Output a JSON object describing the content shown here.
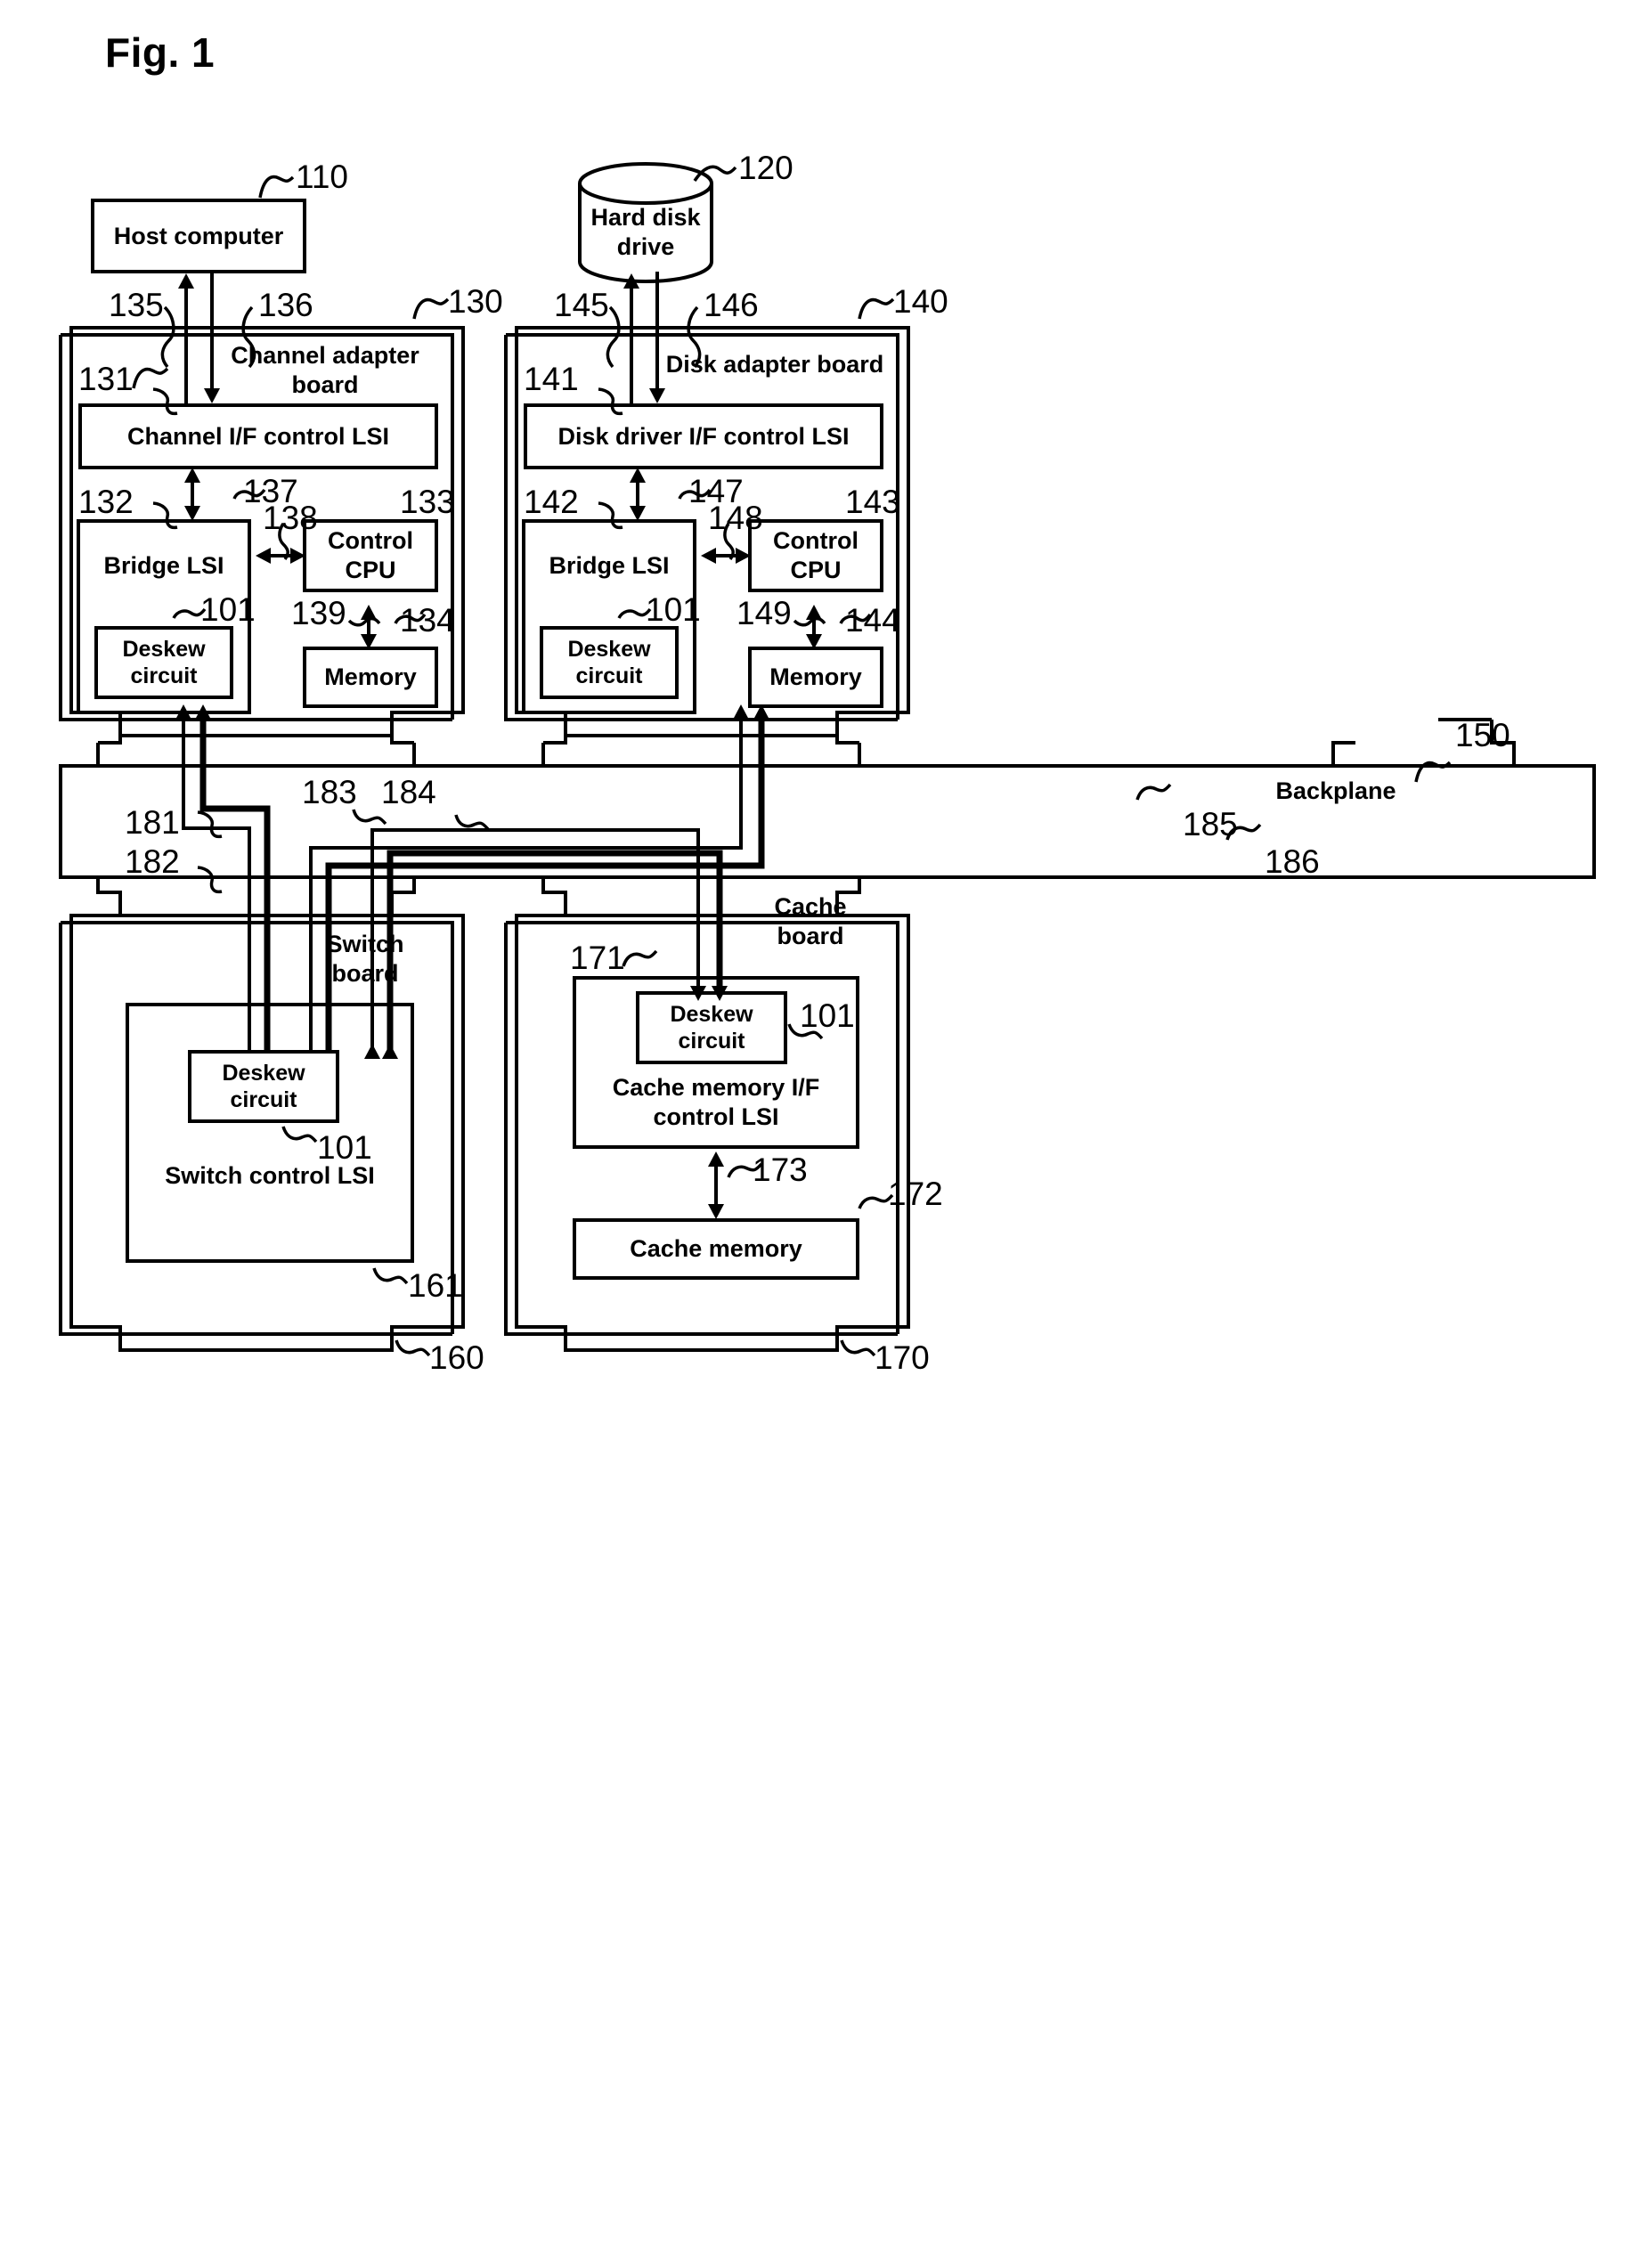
{
  "figure": {
    "title": "Fig. 1"
  },
  "nodes": {
    "host_computer": "Host computer",
    "hard_disk_drive": "Hard disk\ndrive",
    "channel_adapter_board": "Channel adapter\nboard",
    "disk_adapter_board": "Disk adapter board",
    "channel_if_control_lsi": "Channel I/F control LSI",
    "disk_driver_if_control_lsi": "Disk driver I/F control LSI",
    "bridge_lsi_ca": "Bridge LSI",
    "bridge_lsi_da": "Bridge LSI",
    "control_cpu_ca": "Control\nCPU",
    "control_cpu_da": "Control\nCPU",
    "memory_ca": "Memory",
    "memory_da": "Memory",
    "deskew_circuit_ca": "Deskew\ncircuit",
    "deskew_circuit_da": "Deskew\ncircuit",
    "deskew_circuit_switch": "Deskew\ncircuit",
    "deskew_circuit_cache": "Deskew\ncircuit",
    "backplane": "Backplane",
    "switch_board": "Switch\nboard",
    "switch_control_lsi": "Switch control LSI",
    "cache_board": "Cache\nboard",
    "cache_memory_if_control_lsi": "Cache memory I/F\ncontrol LSI",
    "cache_memory": "Cache memory"
  },
  "reference_numerals": {
    "n101_bridge_ca": "101",
    "n101_bridge_da": "101",
    "n101_switch": "101",
    "n101_cache": "101",
    "n110": "110",
    "n120": "120",
    "n130": "130",
    "n131": "131",
    "n132": "132",
    "n133": "133",
    "n134": "134",
    "n135": "135",
    "n136": "136",
    "n137": "137",
    "n138": "138",
    "n139": "139",
    "n140": "140",
    "n141": "141",
    "n142": "142",
    "n143": "143",
    "n144": "144",
    "n145": "145",
    "n146": "146",
    "n147": "147",
    "n148": "148",
    "n149": "149",
    "n150": "150",
    "n160": "160",
    "n161": "161",
    "n170": "170",
    "n171": "171",
    "n172": "172",
    "n173": "173",
    "n181": "181",
    "n182": "182",
    "n183": "183",
    "n184": "184",
    "n185": "185",
    "n186": "186"
  },
  "colors": {
    "ink": "#000000",
    "paper": "#ffffff"
  }
}
